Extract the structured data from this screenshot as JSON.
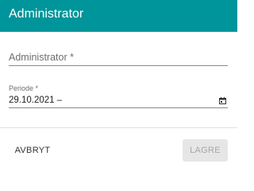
{
  "dialog": {
    "title": "Administrator",
    "header_color": "#00959a"
  },
  "form": {
    "administrator_placeholder": "Administrator *",
    "period_label": "Periode *",
    "period_value": "29.10.2021 –"
  },
  "icons": {
    "period_picker": "calendar-icon"
  },
  "actions": {
    "cancel_label": "AVBRYT",
    "save_label": "LAGRE",
    "save_disabled": true
  }
}
